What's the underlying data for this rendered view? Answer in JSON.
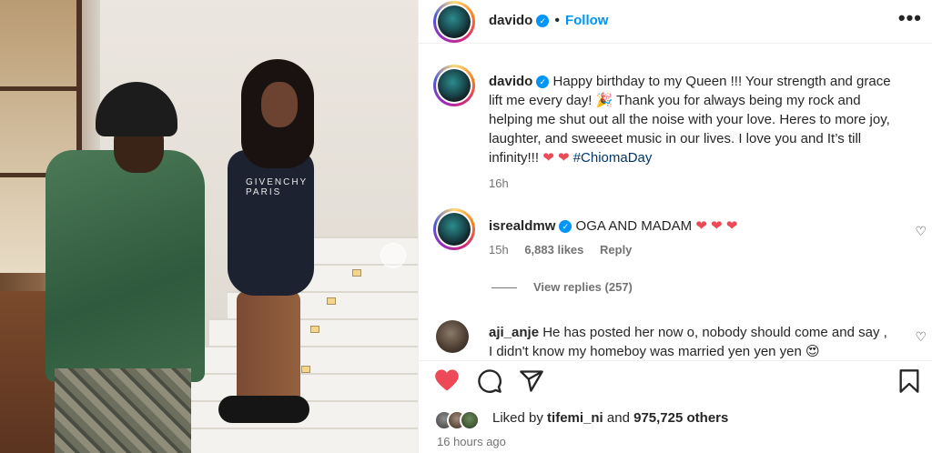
{
  "post": {
    "photo_print_text": "GIVENCHY PARIS",
    "author": "davido",
    "follow_label": "Follow",
    "more_label": "•••"
  },
  "caption": {
    "username": "davido",
    "text": "Happy birthday to my Queen !!! Your strength and grace lift me every day! 🎉 Thank you for always being my rock and helping me shut out all the noise with your love. Heres to more joy, laughter, and sweeeet music in our lives. I love you and It’s till infinity!!!",
    "hearts": "❤ ❤",
    "hashtag": "#ChiomaDay",
    "time": "16h"
  },
  "comments": [
    {
      "username": "isrealdmw",
      "text": "OGA AND MADAM",
      "hearts": "❤ ❤ ❤",
      "time": "15h",
      "likes": "6,883 likes",
      "reply_label": "Reply",
      "view_replies": "View replies (257)"
    },
    {
      "username": "aji_anje",
      "text": "He has posted her now o, nobody should come and say , I didn't know my homeboy was married yen yen yen 😍"
    }
  ],
  "likes": {
    "prefix": "Liked by",
    "user": "tifemi_ni",
    "and": "and",
    "count": "975,725 others"
  },
  "post_time": "16 hours ago",
  "colors": {
    "link_blue": "#0095f6",
    "heart_red": "#ed4956",
    "text": "#262626",
    "muted": "#737373"
  },
  "icons": [
    "heart-icon",
    "comment-icon",
    "share-icon",
    "bookmark-icon",
    "more-icon",
    "verified-icon"
  ]
}
